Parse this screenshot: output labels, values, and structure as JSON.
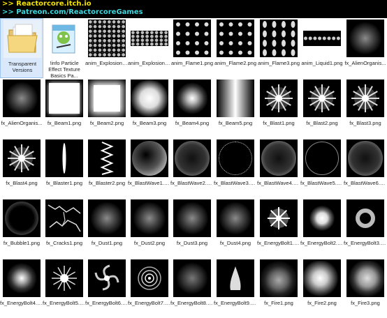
{
  "banner": {
    "line1": ">> Reactorcore.itch.io",
    "line2": ">> Patreon.com/ReactorcoreGames",
    "color1": "#f4e200",
    "color2": "#3cd9e0"
  },
  "files": [
    {
      "label": "Transparent Versions",
      "icon": "folder-icon",
      "kind": "folder"
    },
    {
      "label": "!info Particle Effect Texture Basics Pa...",
      "icon": "notepad-file-icon",
      "kind": "notepad"
    },
    {
      "label": "anim_ExplosionC...",
      "icon": "sprite-grid-icon",
      "kind": "grid8"
    },
    {
      "label": "anim_ExplosionC...",
      "icon": "sprite-grid-icon",
      "kind": "grid8small"
    },
    {
      "label": "anim_Flame1.png",
      "icon": "sprite-grid-icon",
      "kind": "grid4"
    },
    {
      "label": "anim_Flame2.png",
      "icon": "sprite-grid-icon",
      "kind": "grid4b"
    },
    {
      "label": "anim_Flame3.png",
      "icon": "sprite-grid-icon",
      "kind": "flame3"
    },
    {
      "label": "anim_Liquid1.png",
      "icon": "sprite-grid-icon",
      "kind": "liquid"
    },
    {
      "label": "fx_AlienOrganis...",
      "icon": "particle-icon",
      "kind": "softcircle"
    },
    {
      "label": "fx_AlienOrganis...",
      "icon": "particle-icon",
      "kind": "softcircle2"
    },
    {
      "label": "fx_Beam1.png",
      "icon": "particle-icon",
      "kind": "beam1"
    },
    {
      "label": "fx_Beam2.png",
      "icon": "particle-icon",
      "kind": "beam2"
    },
    {
      "label": "fx_Beam3.png",
      "icon": "particle-icon",
      "kind": "beam3"
    },
    {
      "label": "fx_Beam4.png",
      "icon": "particle-icon",
      "kind": "beam4"
    },
    {
      "label": "fx_Beam5.png",
      "icon": "particle-icon",
      "kind": "beam5"
    },
    {
      "label": "fx_Blast1.png",
      "icon": "particle-icon",
      "kind": "blast"
    },
    {
      "label": "fx_Blast2.png",
      "icon": "particle-icon",
      "kind": "blast2"
    },
    {
      "label": "fx_Blast3.png",
      "icon": "particle-icon",
      "kind": "blast3"
    },
    {
      "label": "fx_Blast4.png",
      "icon": "particle-icon",
      "kind": "blast4"
    },
    {
      "label": "fx_Blaster1.png",
      "icon": "particle-icon",
      "kind": "blaster1"
    },
    {
      "label": "fx_Blaster2.png",
      "icon": "particle-icon",
      "kind": "blaster2"
    },
    {
      "label": "fx_BlastWave1.png",
      "icon": "particle-icon",
      "kind": "wave1"
    },
    {
      "label": "fx_BlastWave2.png",
      "icon": "particle-icon",
      "kind": "wave2"
    },
    {
      "label": "fx_BlastWave3.png",
      "icon": "particle-icon",
      "kind": "wave3"
    },
    {
      "label": "fx_BlastWave4.png",
      "icon": "particle-icon",
      "kind": "wave4"
    },
    {
      "label": "fx_BlastWave5.png",
      "icon": "particle-icon",
      "kind": "wave5"
    },
    {
      "label": "fx_BlastWave6.png",
      "icon": "particle-icon",
      "kind": "wave6"
    },
    {
      "label": "fx_Bubble1.png",
      "icon": "particle-icon",
      "kind": "bubble"
    },
    {
      "label": "fx_Cracks1.png",
      "icon": "particle-icon",
      "kind": "cracks"
    },
    {
      "label": "fx_Dust1.png",
      "icon": "particle-icon",
      "kind": "dust"
    },
    {
      "label": "fx_Dust2.png",
      "icon": "particle-icon",
      "kind": "dust2"
    },
    {
      "label": "fx_Dust3.png",
      "icon": "particle-icon",
      "kind": "dust3"
    },
    {
      "label": "fx_Dust4.png",
      "icon": "particle-icon",
      "kind": "dust4"
    },
    {
      "label": "fx_EnergyBolt1.png",
      "icon": "particle-icon",
      "kind": "bolt1"
    },
    {
      "label": "fx_EnergyBolt2.png",
      "icon": "particle-icon",
      "kind": "bolt2"
    },
    {
      "label": "fx_EnergyBolt3.png",
      "icon": "particle-icon",
      "kind": "bolt3"
    },
    {
      "label": "fx_EnergyBolt4.png",
      "icon": "particle-icon",
      "kind": "bolt4"
    },
    {
      "label": "fx_EnergyBolt5.png",
      "icon": "particle-icon",
      "kind": "bolt5"
    },
    {
      "label": "fx_EnergyBolt6.png",
      "icon": "particle-icon",
      "kind": "bolt6"
    },
    {
      "label": "fx_EnergyBolt7.png",
      "icon": "particle-icon",
      "kind": "bolt7"
    },
    {
      "label": "fx_EnergyBolt8.png",
      "icon": "particle-icon",
      "kind": "bolt8"
    },
    {
      "label": "fx_EnergyBolt9.png",
      "icon": "particle-icon",
      "kind": "bolt9"
    },
    {
      "label": "fx_Fire1.png",
      "icon": "particle-icon",
      "kind": "fire1"
    },
    {
      "label": "fx_Fire2.png",
      "icon": "particle-icon",
      "kind": "fire2"
    },
    {
      "label": "fx_Fire3.png",
      "icon": "particle-icon",
      "kind": "fire3"
    }
  ]
}
